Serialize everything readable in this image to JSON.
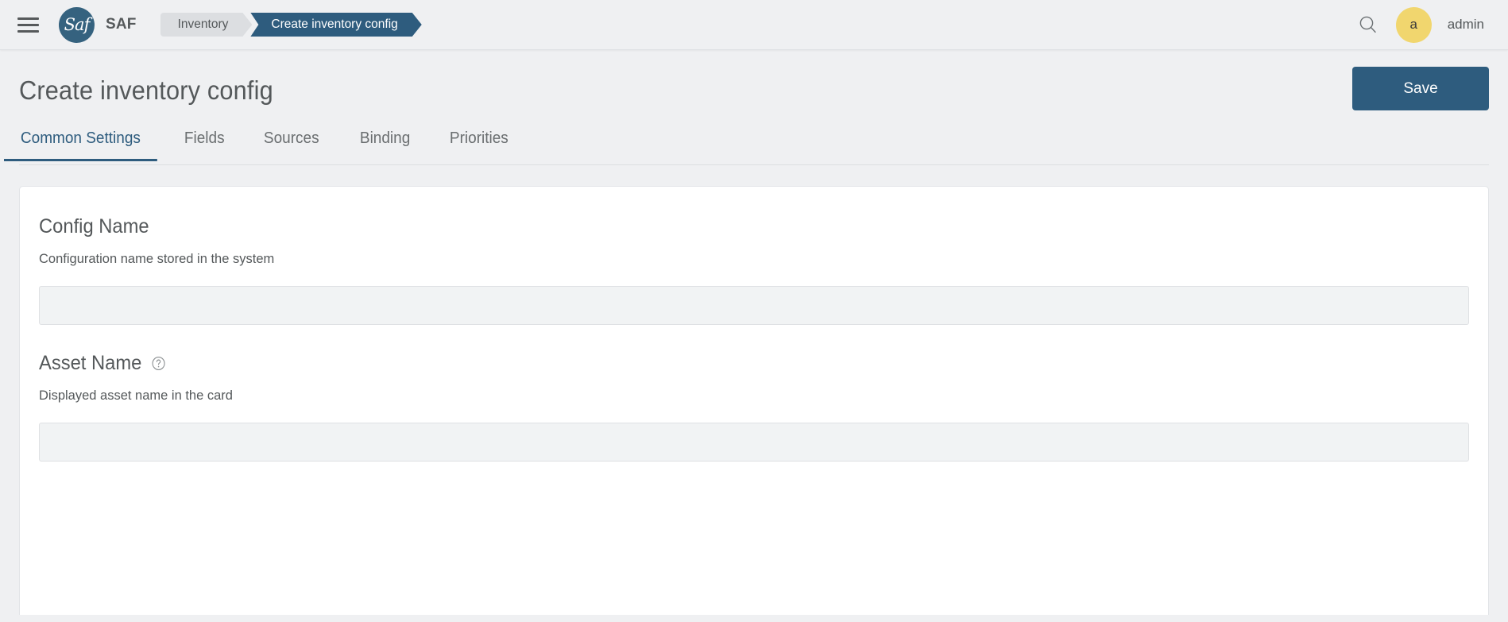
{
  "topbar": {
    "menu_icon": "hamburger-menu-icon",
    "brand": {
      "logo_text": "Saf",
      "name": "SAF"
    },
    "breadcrumbs": [
      {
        "label": "Inventory",
        "active": false
      },
      {
        "label": "Create inventory config",
        "active": true
      }
    ],
    "search_icon": "search-icon",
    "user": {
      "avatar_initial": "a",
      "name": "admin"
    }
  },
  "page": {
    "title": "Create inventory config",
    "save_label": "Save"
  },
  "tabs": [
    {
      "label": "Common Settings",
      "active": true
    },
    {
      "label": "Fields",
      "active": false
    },
    {
      "label": "Sources",
      "active": false
    },
    {
      "label": "Binding",
      "active": false
    },
    {
      "label": "Priorities",
      "active": false
    }
  ],
  "form": {
    "fields": [
      {
        "label": "Config Name",
        "description": "Configuration name stored in the system",
        "value": "",
        "placeholder": "",
        "help_icon": false
      },
      {
        "label": "Asset Name",
        "description": "Displayed asset name in the card",
        "value": "",
        "placeholder": "",
        "help_icon": true,
        "help_icon_name": "help-circle-icon"
      }
    ]
  },
  "colors": {
    "accent": "#2e5c7e",
    "page_background": "#eff0f2",
    "card_background": "#ffffff",
    "input_background": "#f1f3f4",
    "avatar": "#f1d66e",
    "text": "#54585a",
    "breadcrumb_inactive": "#dcdee1"
  }
}
